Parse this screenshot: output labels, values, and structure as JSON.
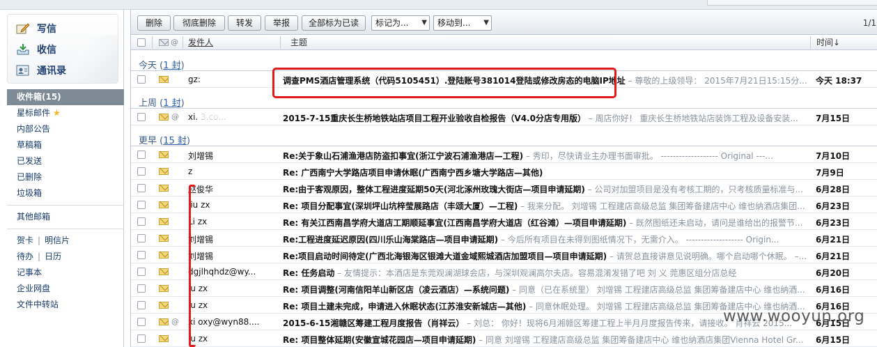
{
  "quick_actions": [
    {
      "label": "写信",
      "icon": "compose-icon"
    },
    {
      "label": "收信",
      "icon": "receive-icon"
    },
    {
      "label": "通讯录",
      "icon": "contacts-icon"
    }
  ],
  "folders": {
    "inbox": "收件箱(15)",
    "starred": "星标邮件",
    "internal": "内部公告",
    "drafts": "草稿箱",
    "sent": "已发送",
    "deleted": "已删除",
    "junk": "垃圾箱",
    "other": "其他邮箱",
    "greeting_card": "贺卡",
    "postcard": "明信片",
    "todo": "待办",
    "calendar": "日历",
    "notes": "记事本",
    "netdisk": "企业网盘",
    "transfer": "文件中转站"
  },
  "toolbar": {
    "delete": "删除",
    "perm_delete": "彻底删除",
    "forward": "转发",
    "report": "举报",
    "mark_all_read": "全部标为已读",
    "mark_as": "标记为...",
    "move_to": "移动到...",
    "pager": "1/1"
  },
  "columns": {
    "sender": "发件人",
    "subject": "主题",
    "time": "时间↓"
  },
  "groups": {
    "today": {
      "name": "今天",
      "count": "(1 封)",
      "count_num": "1 封"
    },
    "last_week": {
      "name": "上周",
      "count_num": "1 封"
    },
    "earlier": {
      "name": "更早",
      "count_num": "15 封"
    }
  },
  "emails": [
    {
      "sender": "gz:",
      "subject": "调查PMS酒店管理系统（代码5105451）.登陆账号381014登陆或修改房态的电脑IP地址",
      "preview": " – 尊敬的上级领导： 2015年7月21日15:15分...",
      "date": "今天 18:37",
      "attach": false
    },
    {
      "sender": "xi.        3.co...",
      "subject": "2015-7-15重庆长生桥地铁站店项目工程开业验收自检报告（V4.0分店专用版）",
      "preview": " – 周店你好！ 重庆长生桥地铁站店装饰工程及设备安装...",
      "date": "7月15日",
      "attach": true
    },
    {
      "sender": "刘增锡",
      "subject": "Re:关于象山石浦渔港店防盗扣事宜(浙江宁波石浦渔港店—工程)",
      "preview": " – 秀印，尽快请业主办理书面审批。 ------------------- Original ---...",
      "date": "7月10日",
      "attach": false
    },
    {
      "sender": "z",
      "subject": "Re: 广西南宁大学路店项目申请休眠(广西南宁西乡塘大学路店—其他)",
      "preview": "",
      "date": "7月9日",
      "attach": false
    },
    {
      "sender": "赵俊华",
      "subject": "Re:由于客观原因，整体工程进度延期50天(河北涿州玫瑰大街店—项目申请延期)",
      "preview": " – 公司对加盟项目是没有考核工期的，只考核质量标准与...",
      "date": "6月28日",
      "attach": false
    },
    {
      "sender": "liu  zx",
      "subject": "Re: 项目分配事宜(深圳坪山坑梓莹展路店（丰颂大厦）—工程)",
      "preview": " – 我来分配。 刘增锡 工程建店高级总监 集团筹备建店中心 维也纳酒店集团...",
      "date": "6月23日",
      "attach": false
    },
    {
      "sender": "Li  zx",
      "subject": "Re: 有关江西南昌学府大道店工期顺延事宜(江西南昌学府大道店（红谷滩）—项目申请延期)",
      "preview": " – 既然图纸还未启动，请问是谁给出的报警节...",
      "date": "6月23日",
      "attach": false
    },
    {
      "sender": "刘增锡",
      "subject": "Re:工程进度延迟原因(四川乐山海棠路店—项目申请延期)",
      "preview": " – 今后所有项目在未得到图纸情况下，无需介入。 ------------------- Origin...",
      "date": "6月21日",
      "attach": false
    },
    {
      "sender": "刘增锡",
      "subject": "Re:项目启动时间待定(广西北海银海区银滩大道金域熙城酒店加盟项目—项目申请延期)",
      "preview": " – 请贺总直接讲意见说明确。哪个启动哪个休眠。 –...",
      "date": "6月21日",
      "attach": false
    },
    {
      "sender": "dgjlhqhdz@wy...",
      "subject": "Re: 任务启动",
      "preview": " – 友情提示：本酒店是东莞观澜湖球会店，与深圳观澜高尔夫店。容易混淆发错了吧 刘 义 莞惠区组分店总经",
      "date": "6月20日",
      "attach": false
    },
    {
      "sender": "iu  zx",
      "subject": "Re: 项目调整(河南信阳羊山新区店（凌云酒店）—系统问题)",
      "preview": " – 同意（已在系统里） 刘增锡 工程建店高级总监 集团筹备建店中心 维也纳酒...",
      "date": "6月16日",
      "attach": false
    },
    {
      "sender": "iu  zx",
      "subject": "Re: 项目土建未完成，申请进入休眠状态(江苏淮安新城店—其他)",
      "preview": " – 同意休眠处理。 刘增锡 工程建店高级总监 集团筹备建店中心 维也纳酒...",
      "date": "6月16日",
      "attach": false
    },
    {
      "sender": "xi  oxy@wyn88....",
      "subject": "2015-6-15湘赣区筹建工程月度报告（肖祥云）",
      "preview": " – 刘总： 你好！现将6月湘赣区筹建工程上半月月度报告传来，请接收。 肖祥云 2015...",
      "date": "6月15日",
      "attach": true
    },
    {
      "sender": "iu  zx",
      "subject": "Re: 项目整体延期(安徽宣城花园店—项目申请延期)",
      "preview": " – 同意 刘增锡 工程建店高级总监 集团筹备建店中心 维也纳酒店集团Vienna Hotel Gr...",
      "date": "6月15日",
      "attach": false
    }
  ],
  "watermark": "www.wooyun.org",
  "colors": {
    "highlight": "#e21a1a",
    "active_folder": "#7e8b97",
    "link": "#3b5e87"
  }
}
